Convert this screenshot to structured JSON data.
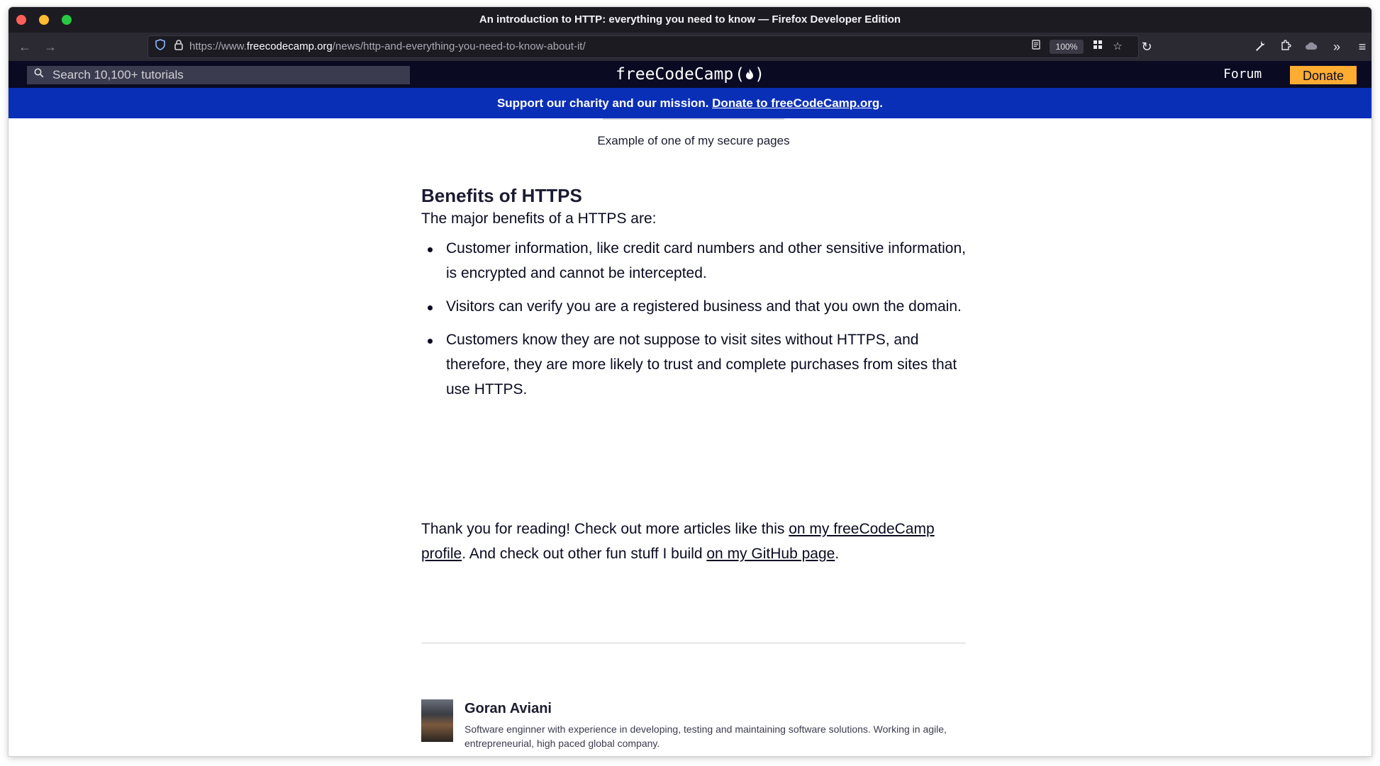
{
  "browser": {
    "window_title": "An introduction to HTTP: everything you need to know — Firefox Developer Edition",
    "url_prefix": "https://www.",
    "url_domain": "freecodecamp.org",
    "url_path": "/news/http-and-everything-you-need-to-know-about-it/",
    "zoom": "100%",
    "icons": [
      "back-icon",
      "forward-icon",
      "shield-icon",
      "lock-icon",
      "reader-view-icon",
      "extensions-grid-icon",
      "star-icon",
      "reload-icon",
      "wrench-icon",
      "puzzle-icon",
      "cloud-icon",
      "overflow-chevrons-icon",
      "hamburger-menu-icon"
    ]
  },
  "site_header": {
    "search_placeholder": "Search 10,100+ tutorials",
    "logo_text": "freeCodeCamp",
    "forum_label": "Forum",
    "donate_label": "Donate",
    "donate_color": "#feac32",
    "header_color": "#0a0a23"
  },
  "banner": {
    "text": "Support our charity and our mission. ",
    "link_text": "Donate to freeCodeCamp.org",
    "suffix": ".",
    "color": "#0a2fb7"
  },
  "article": {
    "image_caption": "Example of one of my secure pages",
    "heading": "Benefits of HTTPS",
    "intro": "The major benefits of a HTTPS are:",
    "benefits": [
      "Customer information, like credit card numbers and other sensitive information, is encrypted and cannot be intercepted.",
      "Visitors can verify you are a registered business and that you own the domain.",
      "Customers know they are not suppose to visit sites without HTTPS, and therefore, they are more likely to trust and complete purchases from sites that use HTTPS."
    ],
    "outro_part1": "Thank you for reading! Check out more articles like this ",
    "outro_link1": "on my freeCodeCamp profile",
    "outro_part2": ". And check out other fun stuff I build ",
    "outro_link2": "on my GitHub page",
    "outro_part3": "."
  },
  "author": {
    "name": "Goran Aviani",
    "bio": "Software enginner with experience in developing, testing and maintaining software solutions. Working in agile, entrepreneurial, high paced global company."
  }
}
